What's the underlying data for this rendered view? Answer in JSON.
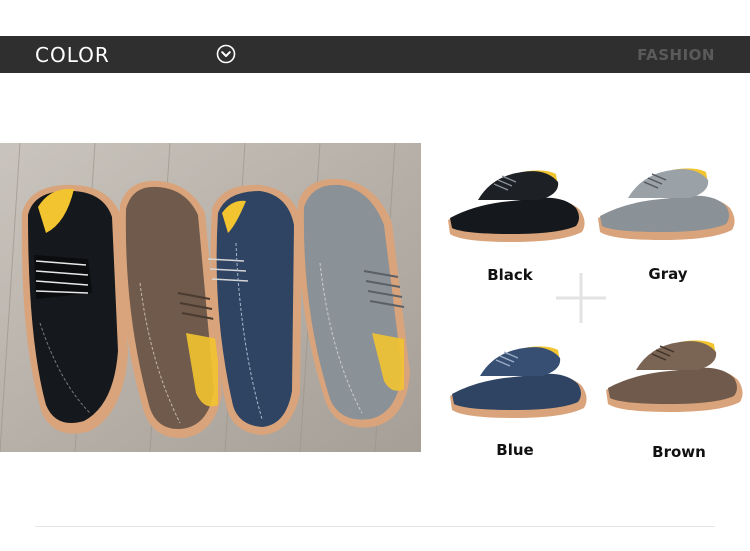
{
  "header": {
    "title": "COLOR",
    "right_text": "FASHION",
    "icon": "chevron-down-circle-icon"
  },
  "colors": {
    "header_bg": "#2f2f2f",
    "black": "#15181c",
    "gray": "#8a9197",
    "blue": "#2f4463",
    "brown": "#6f5a4c",
    "sole": "#d9a47b",
    "lining": "#f2c430"
  },
  "variants": [
    {
      "label": "Black"
    },
    {
      "label": "Gray"
    },
    {
      "label": "Blue"
    },
    {
      "label": "Brown"
    }
  ]
}
